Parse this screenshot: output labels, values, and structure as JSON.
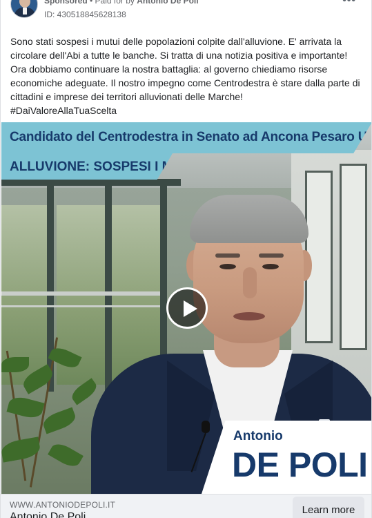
{
  "header": {
    "sponsored_label": "Sponsored",
    "separator": " • ",
    "paid_by_prefix": "Paid for by ",
    "paid_by_name": "Antonio De Poli",
    "ad_id": "ID: 430518845628138",
    "more_icon": "more-horizontal-icon"
  },
  "post": {
    "text": "Sono stati sospesi i mutui delle popolazioni colpite dall'alluvione. E' arrivata la circolare dell'Abi a tutte le banche. Si tratta di una notizia positiva e importante! Ora dobbiamo continuare la nostra battaglia: al governo chiediamo risorse economiche adeguate. Il nostro impegno come Centrodestra è stare dalla parte di cittadini e imprese dei territori alluvionati delle Marche!",
    "hashtag": "#DaiValoreAllaTuaScelta"
  },
  "media": {
    "banner_line1": "Candidato del Centrodestra in Senato ad Ancona Pesaro Urbino",
    "banner_line2": "ALLUVIONE: SOSPESI I MUTUI",
    "name_first": "Antonio",
    "name_last": "DE POLI",
    "play_icon": "play-icon",
    "banner_color": "#7dc3d4",
    "text_color": "#173a6b"
  },
  "footer": {
    "domain": "WWW.ANTONIODEPOLI.IT",
    "headline": "Antonio De Poli",
    "cta_label": "Learn more"
  }
}
